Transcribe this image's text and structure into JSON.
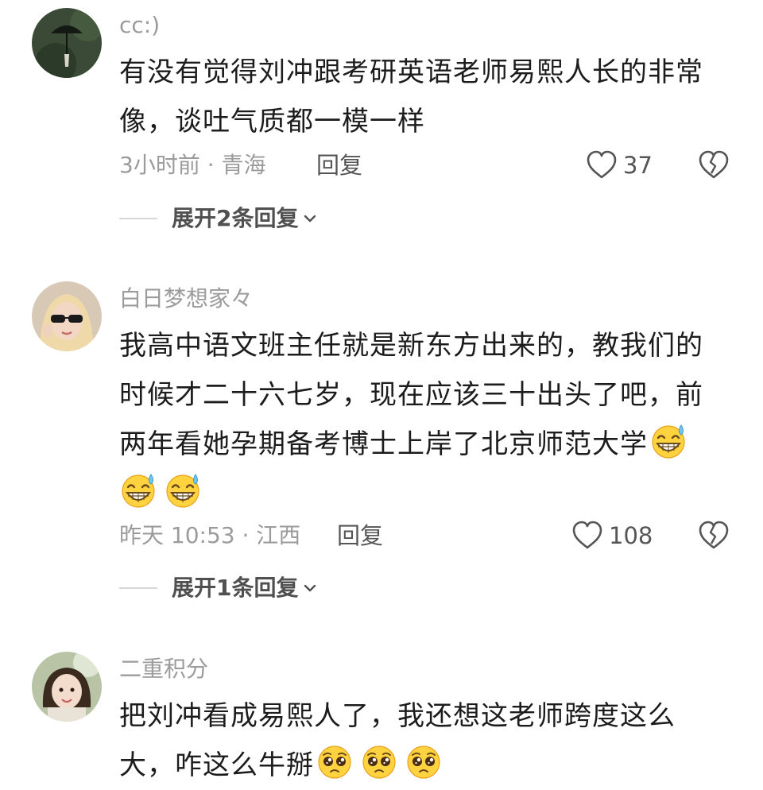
{
  "comments": [
    {
      "username": "cc:)",
      "lines": [
        "有没有觉得刘冲跟考研英语老师易熙人长的非常",
        "像，谈吐气质都一模一样"
      ],
      "meta": "3小时前 · 青海",
      "reply_label": "回复",
      "likes": "37",
      "expand_label": "展开2条回复"
    },
    {
      "username": "白日梦想家々",
      "lines": [
        "我高中语文班主任就是新东方出来的，教我们的",
        "时候才二十六七岁，现在应该三十出头了吧，前",
        "两年看她孕期备考博士上岸了北京师范大学",
        ""
      ],
      "meta": "昨天 10:53 · 江西",
      "reply_label": "回复",
      "likes": "108",
      "expand_label": "展开1条回复"
    },
    {
      "username": "二重积分",
      "lines": [
        "把刘冲看成易熙人了，我还想这老师跨度这么",
        "大，咋这么牛掰"
      ]
    }
  ],
  "icons": {
    "like": "heart-outline-icon",
    "dislike": "broken-heart-icon",
    "expand": "chevron-down-icon",
    "emoji_sweat": "grin-sweat-emoji",
    "emoji_pleading": "pleading-emoji"
  },
  "colors": {
    "text": "#1c1c1c",
    "secondary": "#9b9b9b",
    "action": "#555555"
  }
}
